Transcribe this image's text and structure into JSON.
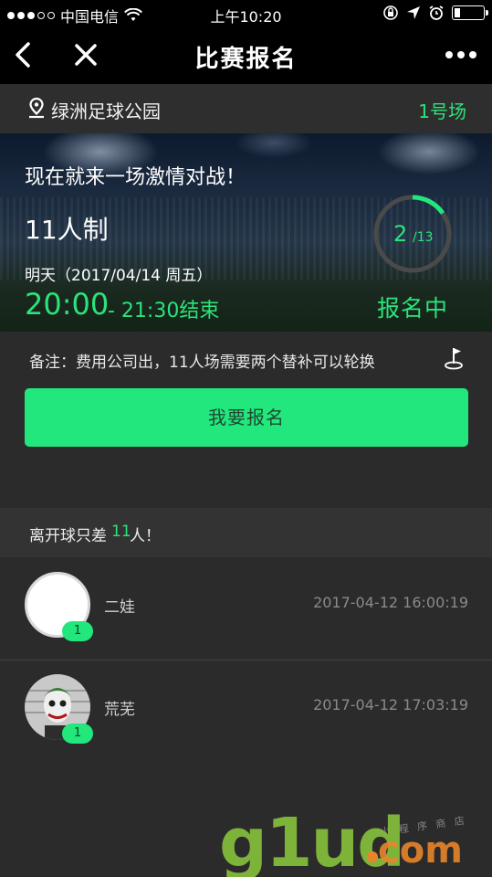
{
  "status_bar": {
    "carrier": "中国电信",
    "time": "上午10:20",
    "battery_level": 0.2
  },
  "nav": {
    "title": "比赛报名",
    "back_icon": "chevron-left-icon",
    "close_icon": "close-icon",
    "more_icon": "more-dots-icon"
  },
  "location": {
    "venue": "绿洲足球公园",
    "field": "1号场"
  },
  "match": {
    "slogan": "现在就来一场激情对战！",
    "format": "11人制",
    "date": "明天（2017/04/14 周五）",
    "start_time": "20:00",
    "end_time": "- 21:30结束",
    "signed": "2",
    "capacity": "/13",
    "progress": 0.154,
    "status": "报名中"
  },
  "note": {
    "text": "备注：费用公司出，11人场需要两个替补可以轮换"
  },
  "signup_button": "我要报名",
  "remaining": {
    "prefix": "离开球只差",
    "count": "11",
    "suffix": "人！"
  },
  "participants": [
    {
      "name": "二娃",
      "time": "2017-04-12 16:00:19",
      "count": "1"
    },
    {
      "name": "荒芜",
      "time": "2017-04-12 17:03:19",
      "count": "1"
    }
  ],
  "watermark": {
    "brand": "g1ud",
    "tld": "com",
    "tagline": "小 程 序 商 店"
  },
  "colors": {
    "accent": "#21e77c",
    "background": "#2b2b2b",
    "nav": "#000000"
  }
}
